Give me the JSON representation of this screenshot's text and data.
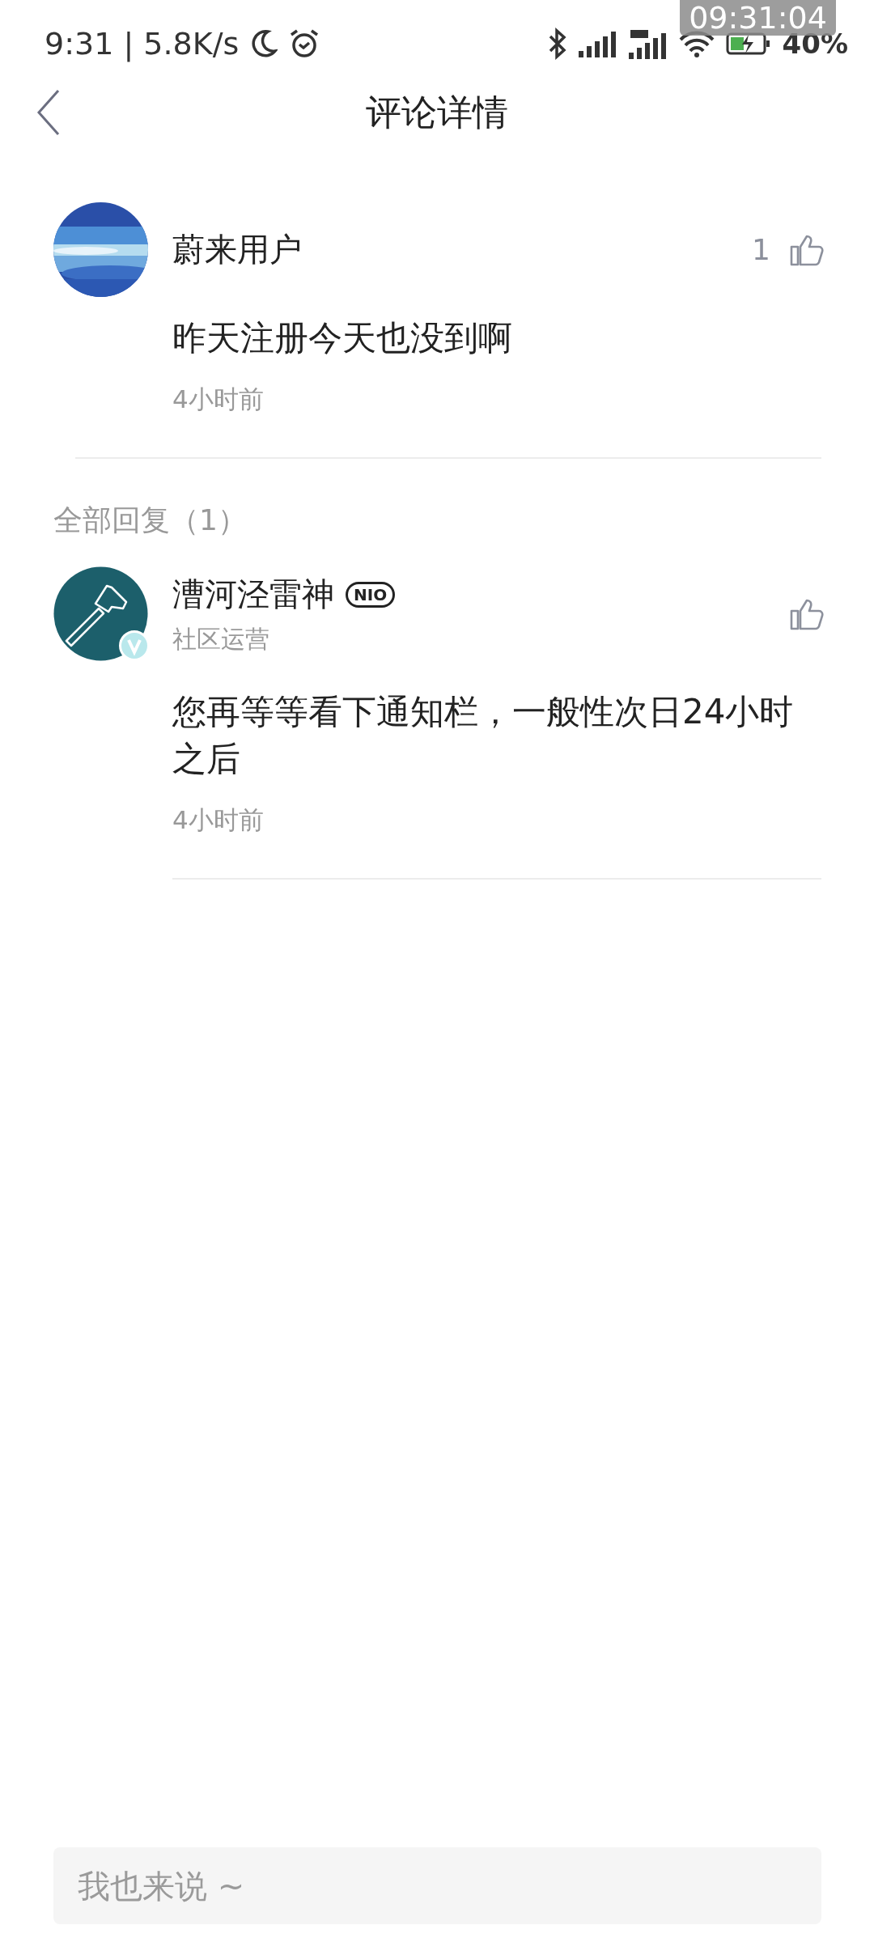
{
  "status_bar": {
    "time": "9:31 | 5.8K/s",
    "battery": "40%",
    "overlay_clock": "09:31:04"
  },
  "header": {
    "title": "评论详情"
  },
  "comment": {
    "author": "蔚来用户",
    "likes": "1",
    "text": "昨天注册今天也没到啊",
    "time": "4小时前"
  },
  "replies_heading": "全部回复（1）",
  "replies": [
    {
      "author": "漕河泾雷神",
      "badge": "NIO",
      "role": "社区运营",
      "verified": true,
      "text": "您再等等看下通知栏，一般性次日24小时之后",
      "time": "4小时前"
    }
  ],
  "input": {
    "placeholder": "我也来说 ~"
  }
}
